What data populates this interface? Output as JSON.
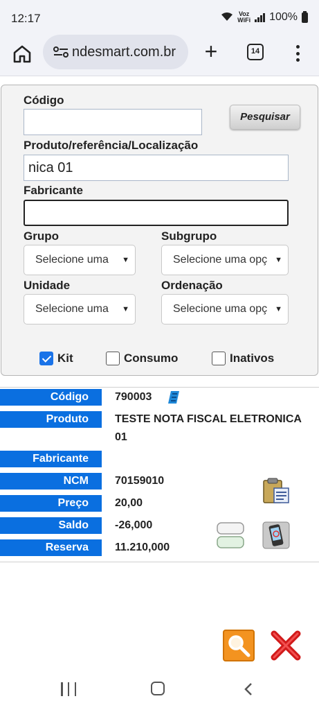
{
  "status_bar": {
    "time": "12:17",
    "volte_line1": "Voz",
    "volte_line2": "WiFi",
    "battery": "100%"
  },
  "browser": {
    "url": "ndesmart.com.br",
    "tab_count": "14"
  },
  "filter": {
    "codigo_label": "Código",
    "codigo_value": "",
    "search_button": "Pesquisar",
    "produto_label": "Produto/referência/Localização",
    "produto_value": "nica 01",
    "fabricante_label": "Fabricante",
    "fabricante_value": "",
    "grupo_label": "Grupo",
    "grupo_value": "Selecione uma",
    "subgrupo_label": "Subgrupo",
    "subgrupo_value": "Selecione uma opç",
    "unidade_label": "Unidade",
    "unidade_value": "Selecione uma",
    "ordenacao_label": "Ordenação",
    "ordenacao_value": "Selecione uma opç",
    "checkboxes": [
      {
        "label": "Kit",
        "checked": true
      },
      {
        "label": "Consumo",
        "checked": false
      },
      {
        "label": "Inativos",
        "checked": false
      }
    ]
  },
  "result": {
    "codigo_label": "Código",
    "codigo_value": "790003",
    "produto_label": "Produto",
    "produto_value_line1": "TESTE NOTA FISCAL ELETRONICA",
    "produto_value_line2": "01",
    "fabricante_label": "Fabricante",
    "fabricante_value": "",
    "ncm_label": "NCM",
    "ncm_value": "70159010",
    "preco_label": "Preço",
    "preco_value": "20,00",
    "saldo_label": "Saldo",
    "saldo_value": "-26,000",
    "reserva_label": "Reserva",
    "reserva_value": "11.210,000"
  },
  "icons": {
    "edit": "edit-icon",
    "clipboard": "clipboard-icon",
    "stack": "stack-icon",
    "phone": "phone-icon",
    "search": "search-icon",
    "close": "close-icon"
  },
  "colors": {
    "label_bg": "#0a6fe0",
    "search_btn": "#f39320",
    "close_red": "#d11a1a",
    "checkbox_blue": "#1a73e8"
  }
}
